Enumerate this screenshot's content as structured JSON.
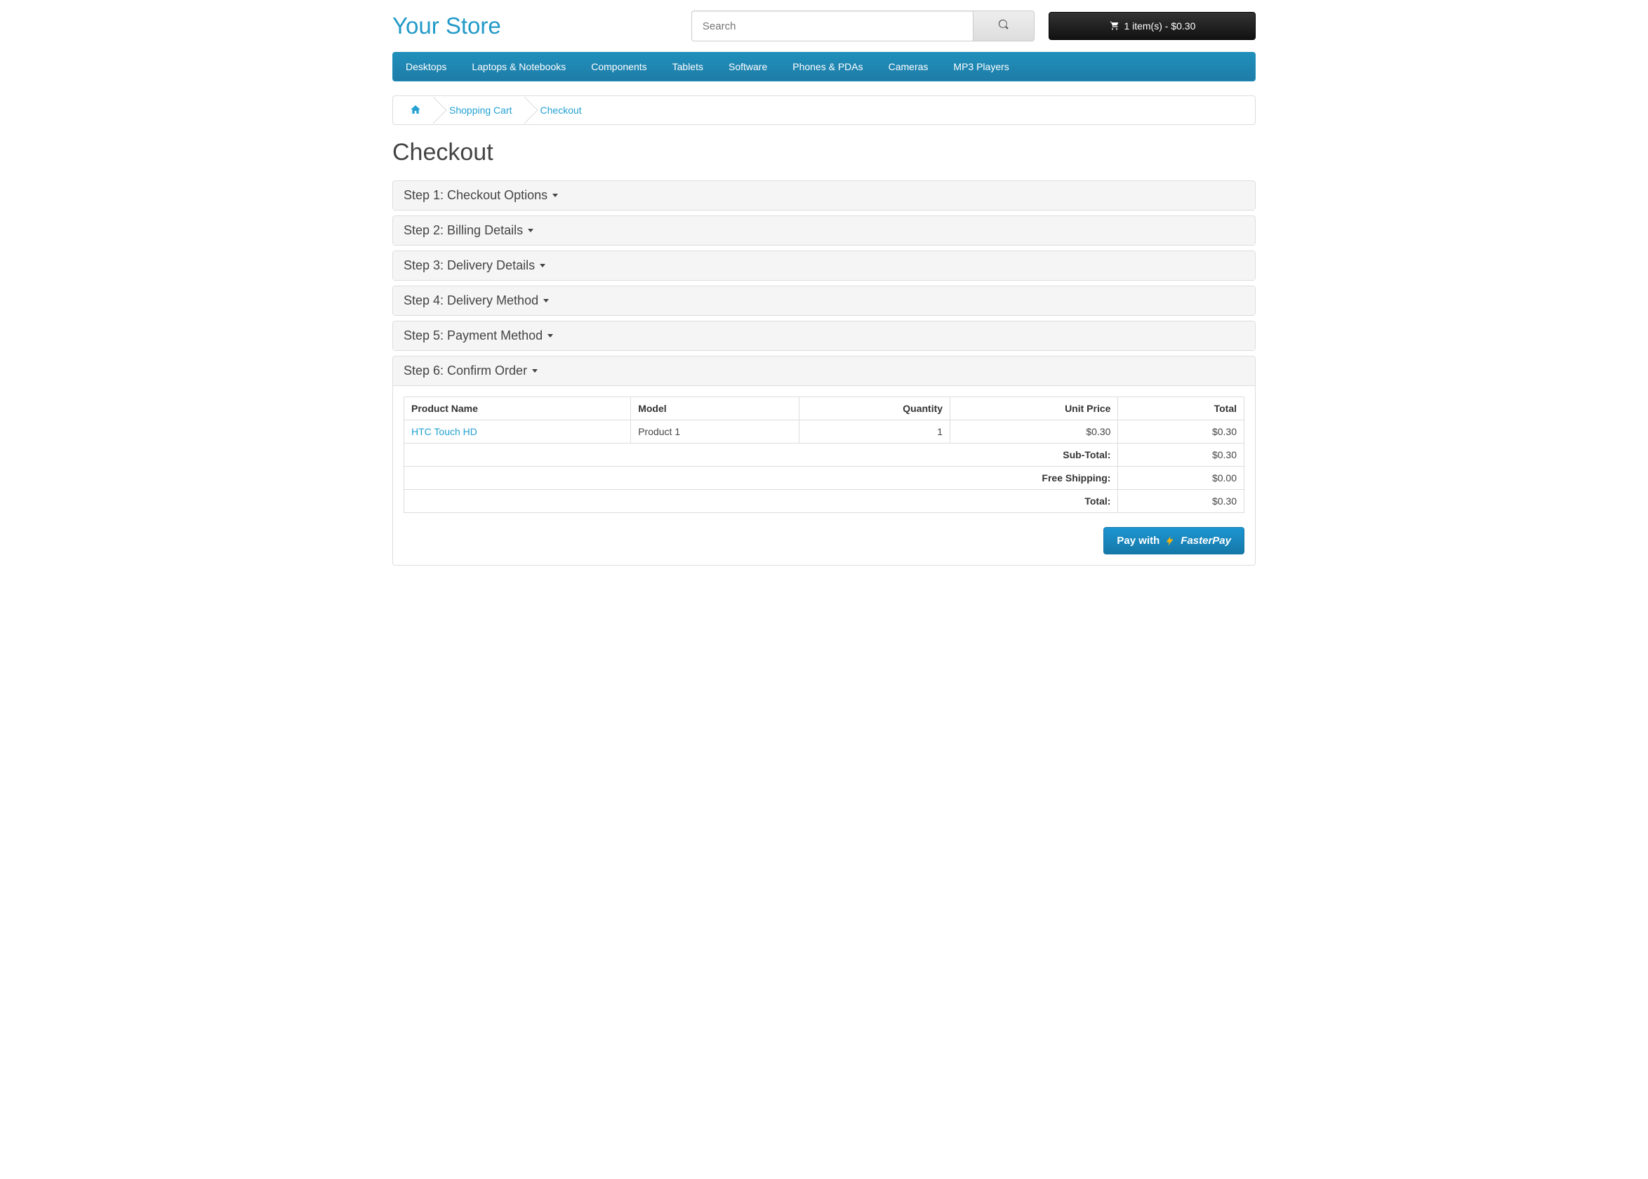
{
  "header": {
    "store_name": "Your Store",
    "search_placeholder": "Search",
    "cart_label": "1 item(s) - $0.30"
  },
  "nav": {
    "items": [
      "Desktops",
      "Laptops & Notebooks",
      "Components",
      "Tablets",
      "Software",
      "Phones & PDAs",
      "Cameras",
      "MP3 Players"
    ]
  },
  "breadcrumb": {
    "shopping_cart": "Shopping Cart",
    "checkout": "Checkout"
  },
  "page_title": "Checkout",
  "steps": [
    "Step 1: Checkout Options",
    "Step 2: Billing Details",
    "Step 3: Delivery Details",
    "Step 4: Delivery Method",
    "Step 5: Payment Method",
    "Step 6: Confirm Order"
  ],
  "order": {
    "columns": {
      "product_name": "Product Name",
      "model": "Model",
      "quantity": "Quantity",
      "unit_price": "Unit Price",
      "total": "Total"
    },
    "rows": [
      {
        "product_name": "HTC Touch HD",
        "model": "Product 1",
        "quantity": "1",
        "unit_price": "$0.30",
        "total": "$0.30"
      }
    ],
    "summary": [
      {
        "label": "Sub-Total:",
        "value": "$0.30"
      },
      {
        "label": "Free Shipping:",
        "value": "$0.00"
      },
      {
        "label": "Total:",
        "value": "$0.30"
      }
    ]
  },
  "pay": {
    "prefix": "Pay with",
    "brand": "FasterPay"
  }
}
